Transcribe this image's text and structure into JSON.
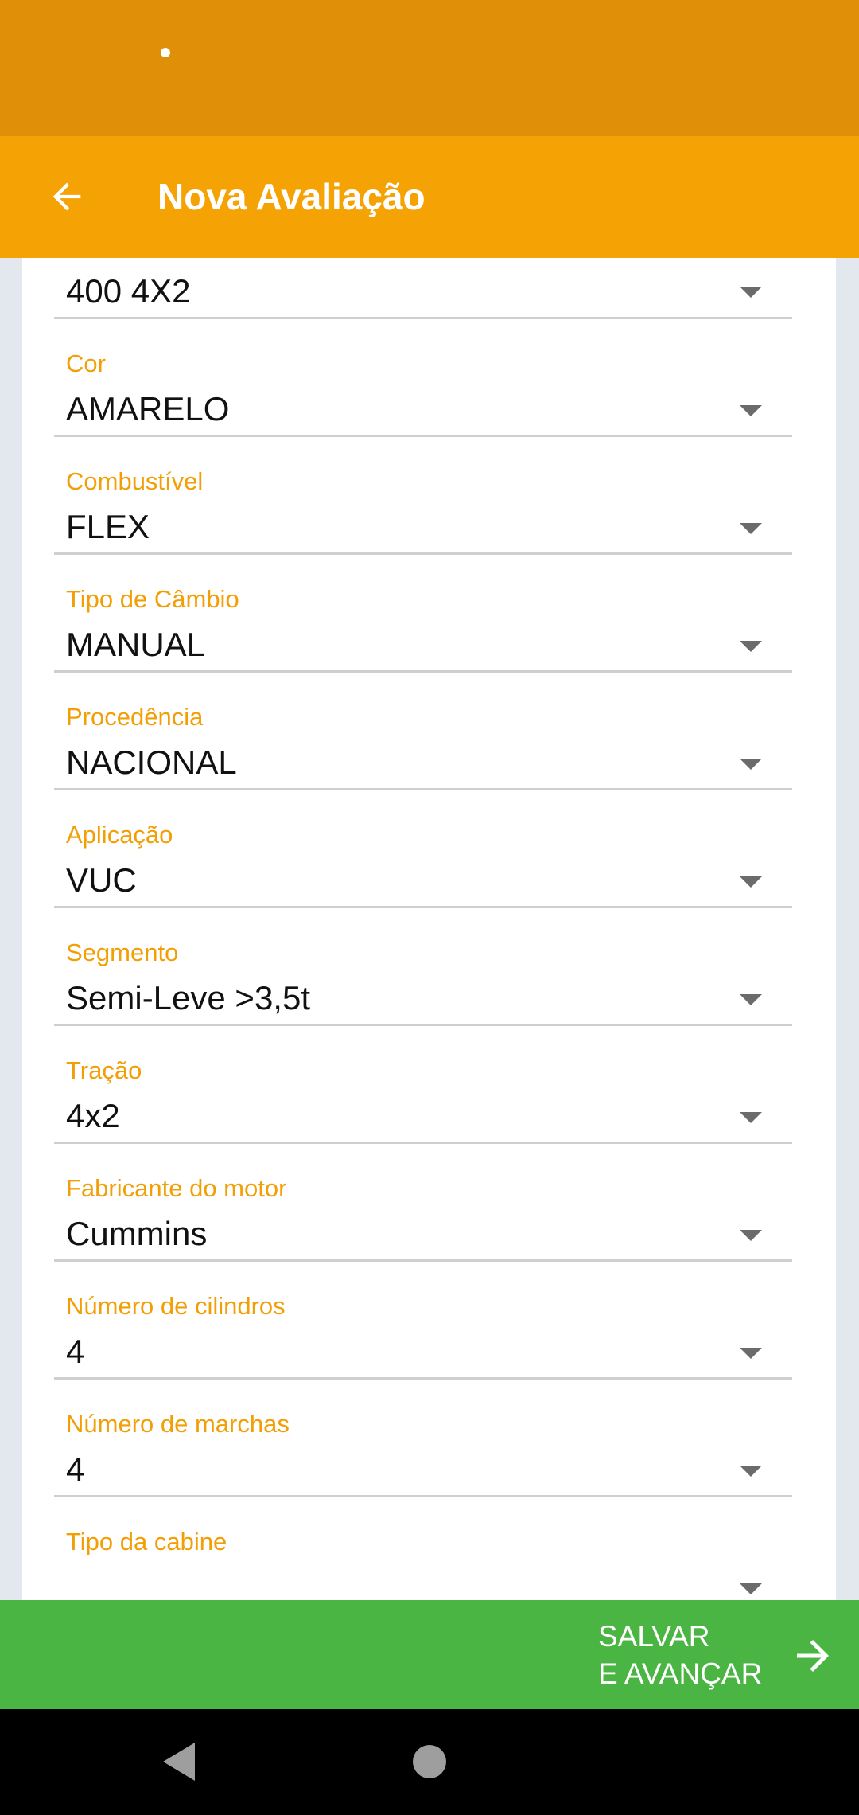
{
  "app_bar": {
    "title": "Nova Avaliação"
  },
  "icons": {
    "back": "arrow-left-icon",
    "dropdown": "triangle-down-icon",
    "save": "arrow-right-icon",
    "nav_back": "triangle-left-icon",
    "nav_home": "circle-icon"
  },
  "form": {
    "fields": [
      {
        "label": "",
        "value": "400 4X2"
      },
      {
        "label": "Cor",
        "value": "AMARELO"
      },
      {
        "label": "Combustível",
        "value": "FLEX"
      },
      {
        "label": "Tipo de Câmbio",
        "value": "MANUAL"
      },
      {
        "label": "Procedência",
        "value": "NACIONAL"
      },
      {
        "label": "Aplicação",
        "value": "VUC"
      },
      {
        "label": "Segmento",
        "value": "Semi-Leve >3,5t"
      },
      {
        "label": "Tração",
        "value": "4x2"
      },
      {
        "label": "Fabricante do motor",
        "value": "Cummins"
      },
      {
        "label": "Número de cilindros",
        "value": "4"
      },
      {
        "label": "Número de marchas",
        "value": "4"
      },
      {
        "label": "Tipo da cabine",
        "value": ""
      }
    ]
  },
  "save_button": {
    "label": "SALVAR\nE AVANÇAR"
  },
  "colors": {
    "status_bar": "#e08f08",
    "app_bar": "#f4a204",
    "label": "#f29f05",
    "save": "#4bb543",
    "background": "#e2e8ee"
  }
}
